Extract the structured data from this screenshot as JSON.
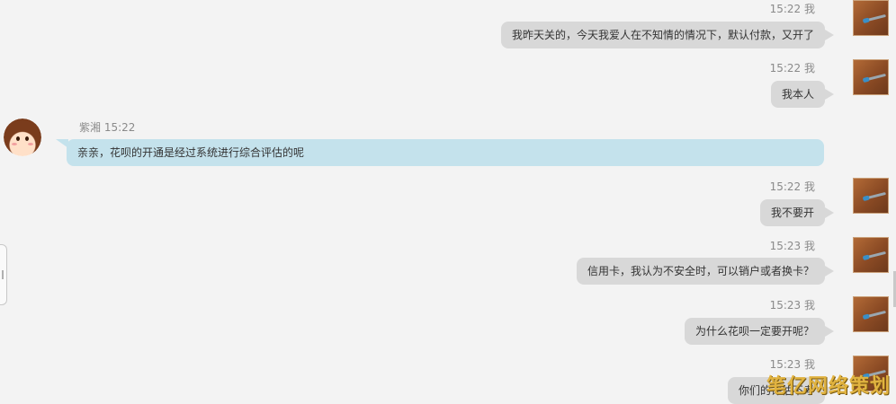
{
  "messages": [
    {
      "meta": "15:22 我",
      "text": "我昨天关的，今天我爱人在不知情的情况下，默认付款，又开了"
    },
    {
      "meta": "15:22 我",
      "text": "我本人"
    },
    {
      "meta": "紫湘 15:22",
      "text": "亲亲，花呗的开通是经过系统进行综合评估的呢"
    },
    {
      "meta": "15:22 我",
      "text": "我不要开"
    },
    {
      "meta": "15:23 我",
      "text": "信用卡，我认为不安全时，可以销户或者换卡？"
    },
    {
      "meta": "15:23 我",
      "text": "为什么花呗一定要开呢？"
    },
    {
      "meta": "15:23 我",
      "text": "你们的评估不考"
    }
  ],
  "watermark": "笔亿网络策划"
}
